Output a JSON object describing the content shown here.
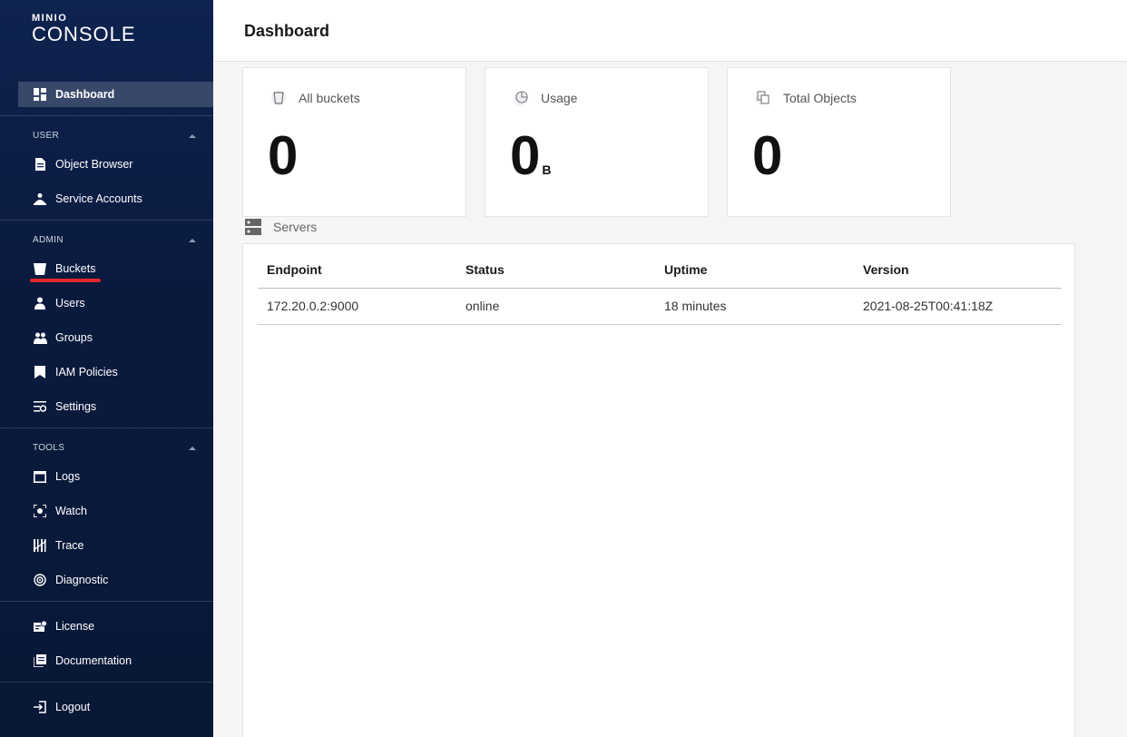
{
  "logo": {
    "brand": "MINIO",
    "product": "CONSOLE"
  },
  "sidebar": {
    "dashboard": "Dashboard",
    "user_header": "USER",
    "user_items": [
      "Object Browser",
      "Service Accounts"
    ],
    "admin_header": "ADMIN",
    "admin_items": [
      "Buckets",
      "Users",
      "Groups",
      "IAM Policies",
      "Settings"
    ],
    "tools_header": "TOOLS",
    "tools_items": [
      "Logs",
      "Watch",
      "Trace",
      "Diagnostic"
    ],
    "extra_items": [
      "License",
      "Documentation"
    ],
    "logout": "Logout",
    "highlight_color": "#e3262c"
  },
  "header": {
    "title": "Dashboard"
  },
  "cards": [
    {
      "title": "All buckets",
      "value": "0",
      "unit": ""
    },
    {
      "title": "Usage",
      "value": "0",
      "unit": "B"
    },
    {
      "title": "Total Objects",
      "value": "0",
      "unit": ""
    }
  ],
  "servers": {
    "label": "Servers",
    "columns": [
      "Endpoint",
      "Status",
      "Uptime",
      "Version"
    ],
    "rows": [
      [
        "172.20.0.2:9000",
        "online",
        "18 minutes",
        "2021-08-25T00:41:18Z"
      ]
    ]
  }
}
